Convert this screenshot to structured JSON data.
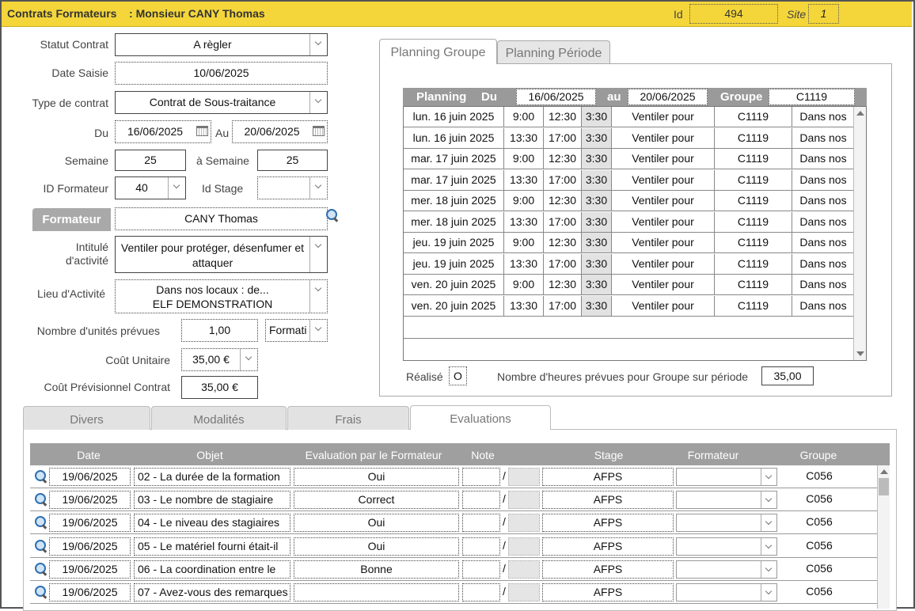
{
  "header": {
    "title": "Contrats Formateurs    : Monsieur CANY Thomas",
    "id_label": "Id",
    "id_value": "494",
    "site_label": "Site",
    "site_value": "1"
  },
  "form": {
    "statut_label": "Statut Contrat",
    "statut_value": "A règler",
    "date_saisie_label": "Date Saisie",
    "date_saisie_value": "10/06/2025",
    "type_label": "Type de contrat",
    "type_value": "Contrat de Sous-traitance",
    "du_label": "Du",
    "du_value": "16/06/2025",
    "au_label": "Au",
    "au_value": "20/06/2025",
    "semaine_label": "Semaine",
    "semaine_value": "25",
    "a_semaine_label": "à Semaine",
    "a_semaine_value": "25",
    "id_formateur_label": "ID Formateur",
    "id_formateur_value": "40",
    "id_stage_label": "Id Stage",
    "id_stage_value": "",
    "formateur_button": "Formateur",
    "formateur_value": "CANY Thomas",
    "intitule_label_1": "Intitulé",
    "intitule_label_2": "d'activité",
    "intitule_value_1": "Ventiler pour protéger, désenfumer et",
    "intitule_value_2": "attaquer",
    "lieu_label": "Lieu d'Activité",
    "lieu_value_1": "Dans nos locaux : de...",
    "lieu_value_2": "ELF DEMONSTRATION",
    "nb_unites_label": "Nombre d'unités prévues",
    "nb_unites_value": "1,00",
    "unite_type_value": "Formati",
    "cout_unitaire_label": "Coût Unitaire",
    "cout_unitaire_value": "35,00 €",
    "cout_prev_label": "Coût Prévisionnel Contrat",
    "cout_prev_value": "35,00 €"
  },
  "top_tabs": [
    {
      "label": "Planning Groupe",
      "active": true
    },
    {
      "label": "Planning Période",
      "active": false
    }
  ],
  "planning": {
    "header_planning": "Planning",
    "header_du": "Du",
    "du_value": "16/06/2025",
    "header_au": "au",
    "au_value": "20/06/2025",
    "header_groupe": "Groupe",
    "groupe_value": "C1119",
    "rows": [
      {
        "day": "lun. 16 juin 2025",
        "start": "9:00",
        "end": "12:30",
        "dur": "3:30",
        "activity": "Ventiler pour",
        "group": "C1119",
        "place": "Dans nos"
      },
      {
        "day": "lun. 16 juin 2025",
        "start": "13:30",
        "end": "17:00",
        "dur": "3:30",
        "activity": "Ventiler pour",
        "group": "C1119",
        "place": "Dans nos"
      },
      {
        "day": "mar. 17 juin 2025",
        "start": "9:00",
        "end": "12:30",
        "dur": "3:30",
        "activity": "Ventiler pour",
        "group": "C1119",
        "place": "Dans nos"
      },
      {
        "day": "mar. 17 juin 2025",
        "start": "13:30",
        "end": "17:00",
        "dur": "3:30",
        "activity": "Ventiler pour",
        "group": "C1119",
        "place": "Dans nos"
      },
      {
        "day": "mer. 18 juin 2025",
        "start": "9:00",
        "end": "12:30",
        "dur": "3:30",
        "activity": "Ventiler pour",
        "group": "C1119",
        "place": "Dans nos"
      },
      {
        "day": "mer. 18 juin 2025",
        "start": "13:30",
        "end": "17:00",
        "dur": "3:30",
        "activity": "Ventiler pour",
        "group": "C1119",
        "place": "Dans nos"
      },
      {
        "day": "jeu. 19 juin 2025",
        "start": "9:00",
        "end": "12:30",
        "dur": "3:30",
        "activity": "Ventiler pour",
        "group": "C1119",
        "place": "Dans nos"
      },
      {
        "day": "jeu. 19 juin 2025",
        "start": "13:30",
        "end": "17:00",
        "dur": "3:30",
        "activity": "Ventiler pour",
        "group": "C1119",
        "place": "Dans nos"
      },
      {
        "day": "ven. 20 juin 2025",
        "start": "9:00",
        "end": "12:30",
        "dur": "3:30",
        "activity": "Ventiler pour",
        "group": "C1119",
        "place": "Dans nos"
      },
      {
        "day": "ven. 20 juin 2025",
        "start": "13:30",
        "end": "17:00",
        "dur": "3:30",
        "activity": "Ventiler pour",
        "group": "C1119",
        "place": "Dans nos"
      }
    ],
    "realise_label": "Réalisé",
    "realise_value": "O",
    "heures_label": "Nombre d'heures prévues pour Groupe sur période",
    "heures_value": "35,00"
  },
  "bottom_tabs": [
    {
      "label": "Divers",
      "active": false
    },
    {
      "label": "Modalités",
      "active": false
    },
    {
      "label": "Frais",
      "active": false
    },
    {
      "label": "Evaluations",
      "active": true
    }
  ],
  "evaluations": {
    "columns": [
      "Date",
      "Objet",
      "Evaluation par le Formateur",
      "Note",
      "Stage",
      "Formateur",
      "Groupe"
    ],
    "rows": [
      {
        "date": "19/06/2025",
        "objet": "02 - La durée de la formation",
        "evaluation": "Oui",
        "note": "/",
        "stage": "AFPS",
        "formateur": "",
        "groupe": "C056"
      },
      {
        "date": "19/06/2025",
        "objet": "03 - Le nombre de stagiaire",
        "evaluation": "Correct",
        "note": "/",
        "stage": "AFPS",
        "formateur": "",
        "groupe": "C056"
      },
      {
        "date": "19/06/2025",
        "objet": "04 - Le niveau des stagiaires",
        "evaluation": "Oui",
        "note": "/",
        "stage": "AFPS",
        "formateur": "",
        "groupe": "C056"
      },
      {
        "date": "19/06/2025",
        "objet": "05 - Le matériel fourni était-il",
        "evaluation": "Oui",
        "note": "/",
        "stage": "AFPS",
        "formateur": "",
        "groupe": "C056"
      },
      {
        "date": "19/06/2025",
        "objet": "06 - La coordination entre le",
        "evaluation": "Bonne",
        "note": "/",
        "stage": "AFPS",
        "formateur": "",
        "groupe": "C056"
      },
      {
        "date": "19/06/2025",
        "objet": "07 - Avez-vous des remarques",
        "evaluation": "",
        "note": "/",
        "stage": "AFPS",
        "formateur": "",
        "groupe": "C056"
      }
    ]
  },
  "colors": {
    "title_bar": "#f4d63a",
    "header_grey": "#9a9a9a"
  }
}
